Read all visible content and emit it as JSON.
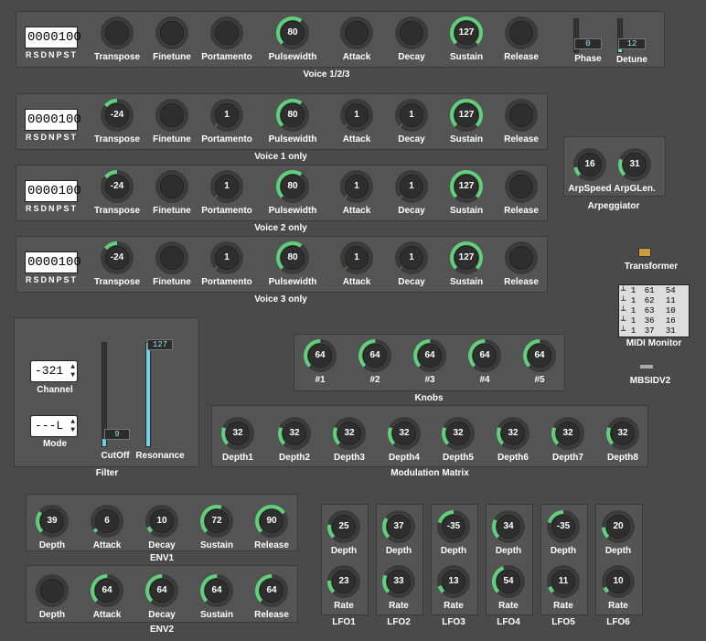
{
  "colors": {
    "bg": "#4a4a4a",
    "panel": "#545454",
    "knob": "#2e2e2e",
    "arc": "#5fd17a",
    "slider_fill": "#6fd3e6"
  },
  "voice_sections": [
    {
      "title": "Voice 1/2/3",
      "number": "0000100",
      "flags": "RSDNPST",
      "knobs": [
        {
          "label": "Transpose",
          "value": ""
        },
        {
          "label": "Finetune",
          "value": ""
        },
        {
          "label": "Portamento",
          "value": ""
        },
        {
          "label": "Pulsewidth",
          "value": "80"
        },
        {
          "label": "Attack",
          "value": ""
        },
        {
          "label": "Decay",
          "value": ""
        },
        {
          "label": "Sustain",
          "value": "127"
        },
        {
          "label": "Release",
          "value": ""
        }
      ],
      "phase": {
        "label": "Phase",
        "value": "0"
      },
      "detune": {
        "label": "Detune",
        "value": "12"
      }
    },
    {
      "title": "Voice 1 only",
      "number": "0000100",
      "flags": "RSDNPST",
      "knobs": [
        {
          "label": "Transpose",
          "value": "-24"
        },
        {
          "label": "Finetune",
          "value": ""
        },
        {
          "label": "Portamento",
          "value": "1"
        },
        {
          "label": "Pulsewidth",
          "value": "80"
        },
        {
          "label": "Attack",
          "value": "1"
        },
        {
          "label": "Decay",
          "value": "1"
        },
        {
          "label": "Sustain",
          "value": "127"
        },
        {
          "label": "Release",
          "value": ""
        }
      ]
    },
    {
      "title": "Voice 2 only",
      "number": "0000100",
      "flags": "RSDNPST",
      "knobs": [
        {
          "label": "Transpose",
          "value": "-24"
        },
        {
          "label": "Finetune",
          "value": ""
        },
        {
          "label": "Portamento",
          "value": "1"
        },
        {
          "label": "Pulsewidth",
          "value": "80"
        },
        {
          "label": "Attack",
          "value": "1"
        },
        {
          "label": "Decay",
          "value": "1"
        },
        {
          "label": "Sustain",
          "value": "127"
        },
        {
          "label": "Release",
          "value": ""
        }
      ]
    },
    {
      "title": "Voice 3 only",
      "number": "0000100",
      "flags": "RSDNPST",
      "knobs": [
        {
          "label": "Transpose",
          "value": "-24"
        },
        {
          "label": "Finetune",
          "value": ""
        },
        {
          "label": "Portamento",
          "value": "1"
        },
        {
          "label": "Pulsewidth",
          "value": "80"
        },
        {
          "label": "Attack",
          "value": "1"
        },
        {
          "label": "Decay",
          "value": "1"
        },
        {
          "label": "Sustain",
          "value": "127"
        },
        {
          "label": "Release",
          "value": ""
        }
      ]
    }
  ],
  "arpeggiator": {
    "title": "Arpeggiator",
    "knobs": [
      {
        "label": "ArpSpeed",
        "value": "16"
      },
      {
        "label": "ArpGLen.",
        "value": "31"
      }
    ]
  },
  "transformer": {
    "label": "Transformer",
    "icon": "keyboard-icon"
  },
  "midi_monitor": {
    "label": "MIDI Monitor",
    "rows": [
      [
        "1",
        "61",
        "54"
      ],
      [
        "1",
        "62",
        "11"
      ],
      [
        "1",
        "63",
        "10"
      ],
      [
        "1",
        "36",
        "16"
      ],
      [
        "1",
        "37",
        "31"
      ]
    ]
  },
  "mbsid": {
    "label": "MBSIDV2",
    "icon": "device-icon"
  },
  "filter": {
    "title": "Filter",
    "channel": {
      "label": "Channel",
      "value": "-321"
    },
    "mode": {
      "label": "Mode",
      "value": "---L"
    },
    "cutoff": {
      "label": "CutOff",
      "value": "9"
    },
    "resonance": {
      "label": "Resonance",
      "value": "127"
    }
  },
  "knobs_panel": {
    "title": "Knobs",
    "knobs": [
      {
        "label": "#1",
        "value": "64"
      },
      {
        "label": "#2",
        "value": "64"
      },
      {
        "label": "#3",
        "value": "64"
      },
      {
        "label": "#4",
        "value": "64"
      },
      {
        "label": "#5",
        "value": "64"
      }
    ]
  },
  "mod_matrix": {
    "title": "Modulation Matrix",
    "knobs": [
      {
        "label": "Depth1",
        "value": "32"
      },
      {
        "label": "Depth2",
        "value": "32"
      },
      {
        "label": "Depth3",
        "value": "32"
      },
      {
        "label": "Depth4",
        "value": "32"
      },
      {
        "label": "Depth5",
        "value": "32"
      },
      {
        "label": "Depth6",
        "value": "32"
      },
      {
        "label": "Depth7",
        "value": "32"
      },
      {
        "label": "Depth8",
        "value": "32"
      }
    ]
  },
  "env1": {
    "title": "ENV1",
    "knobs": [
      {
        "label": "Depth",
        "value": "39"
      },
      {
        "label": "Attack",
        "value": "6"
      },
      {
        "label": "Decay",
        "value": "10"
      },
      {
        "label": "Sustain",
        "value": "72"
      },
      {
        "label": "Release",
        "value": "90"
      }
    ]
  },
  "env2": {
    "title": "ENV2",
    "knobs": [
      {
        "label": "Depth",
        "value": ""
      },
      {
        "label": "Attack",
        "value": "64"
      },
      {
        "label": "Decay",
        "value": "64"
      },
      {
        "label": "Sustain",
        "value": "64"
      },
      {
        "label": "Release",
        "value": "64"
      }
    ]
  },
  "lfos": [
    {
      "title": "LFO1",
      "depth": "25",
      "rate": "23"
    },
    {
      "title": "LFO2",
      "depth": "37",
      "rate": "33"
    },
    {
      "title": "LFO3",
      "depth": "-35",
      "rate": "13"
    },
    {
      "title": "LFO4",
      "depth": "34",
      "rate": "54"
    },
    {
      "title": "LFO5",
      "depth": "-35",
      "rate": "11"
    },
    {
      "title": "LFO6",
      "depth": "20",
      "rate": "10"
    }
  ],
  "lfo_labels": {
    "depth": "Depth",
    "rate": "Rate"
  }
}
